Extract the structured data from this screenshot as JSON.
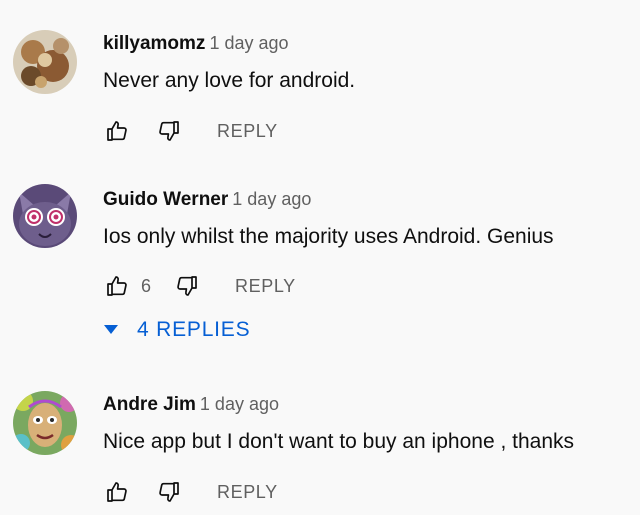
{
  "comments": [
    {
      "author": "killyamomz",
      "time": "1 day ago",
      "text": "Never any love for android.",
      "like_count": "",
      "reply_label": "REPLY"
    },
    {
      "author": "Guido Werner",
      "time": "1 day ago",
      "text": "Ios only whilst the majority uses Android. Genius",
      "like_count": "6",
      "reply_label": "REPLY",
      "replies_label": "4 REPLIES"
    },
    {
      "author": "Andre Jim",
      "time": "1 day ago",
      "text": "Nice app but I don't want to buy an iphone , thanks",
      "like_count": "",
      "reply_label": "REPLY"
    }
  ],
  "icons": {
    "like": "thumb-up-icon",
    "dislike": "thumb-down-icon",
    "expand": "triangle-down-icon"
  },
  "colors": {
    "background": "#f9f9f9",
    "author": "#0f0f0f",
    "meta": "#606060",
    "link": "#065fd4"
  }
}
